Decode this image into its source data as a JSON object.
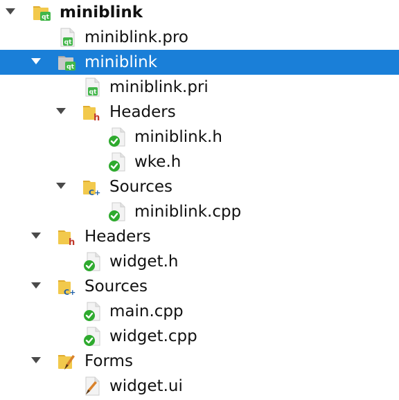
{
  "colors": {
    "selection": "#1a7fd8",
    "folder": "#f2c94c",
    "qt_badge": "#41b649",
    "check_green": "#2eaa2e",
    "header_h": "#c0392b",
    "cpp_blue": "#1f5fa8"
  },
  "tree": [
    {
      "label": "miniblink",
      "icon": "qt-project-folder-icon",
      "expanded": true
    },
    {
      "label": "miniblink.pro",
      "icon": "qt-pro-file-icon"
    },
    {
      "label": "miniblink",
      "icon": "qt-subproject-folder-icon",
      "expanded": true,
      "selected": true
    },
    {
      "label": "miniblink.pri",
      "icon": "qt-pri-file-icon"
    },
    {
      "label": "Headers",
      "icon": "headers-folder-icon",
      "expanded": true
    },
    {
      "label": "miniblink.h",
      "icon": "header-file-check-icon"
    },
    {
      "label": "wke.h",
      "icon": "header-file-check-icon"
    },
    {
      "label": "Sources",
      "icon": "sources-folder-icon",
      "expanded": true
    },
    {
      "label": "miniblink.cpp",
      "icon": "source-file-check-icon"
    },
    {
      "label": "Headers",
      "icon": "headers-folder-icon",
      "expanded": true
    },
    {
      "label": "widget.h",
      "icon": "header-file-check-icon"
    },
    {
      "label": "Sources",
      "icon": "sources-folder-icon",
      "expanded": true
    },
    {
      "label": "main.cpp",
      "icon": "source-file-check-icon"
    },
    {
      "label": "widget.cpp",
      "icon": "source-file-check-icon"
    },
    {
      "label": "Forms",
      "icon": "forms-folder-icon",
      "expanded": true
    },
    {
      "label": "widget.ui",
      "icon": "ui-form-file-icon"
    }
  ]
}
